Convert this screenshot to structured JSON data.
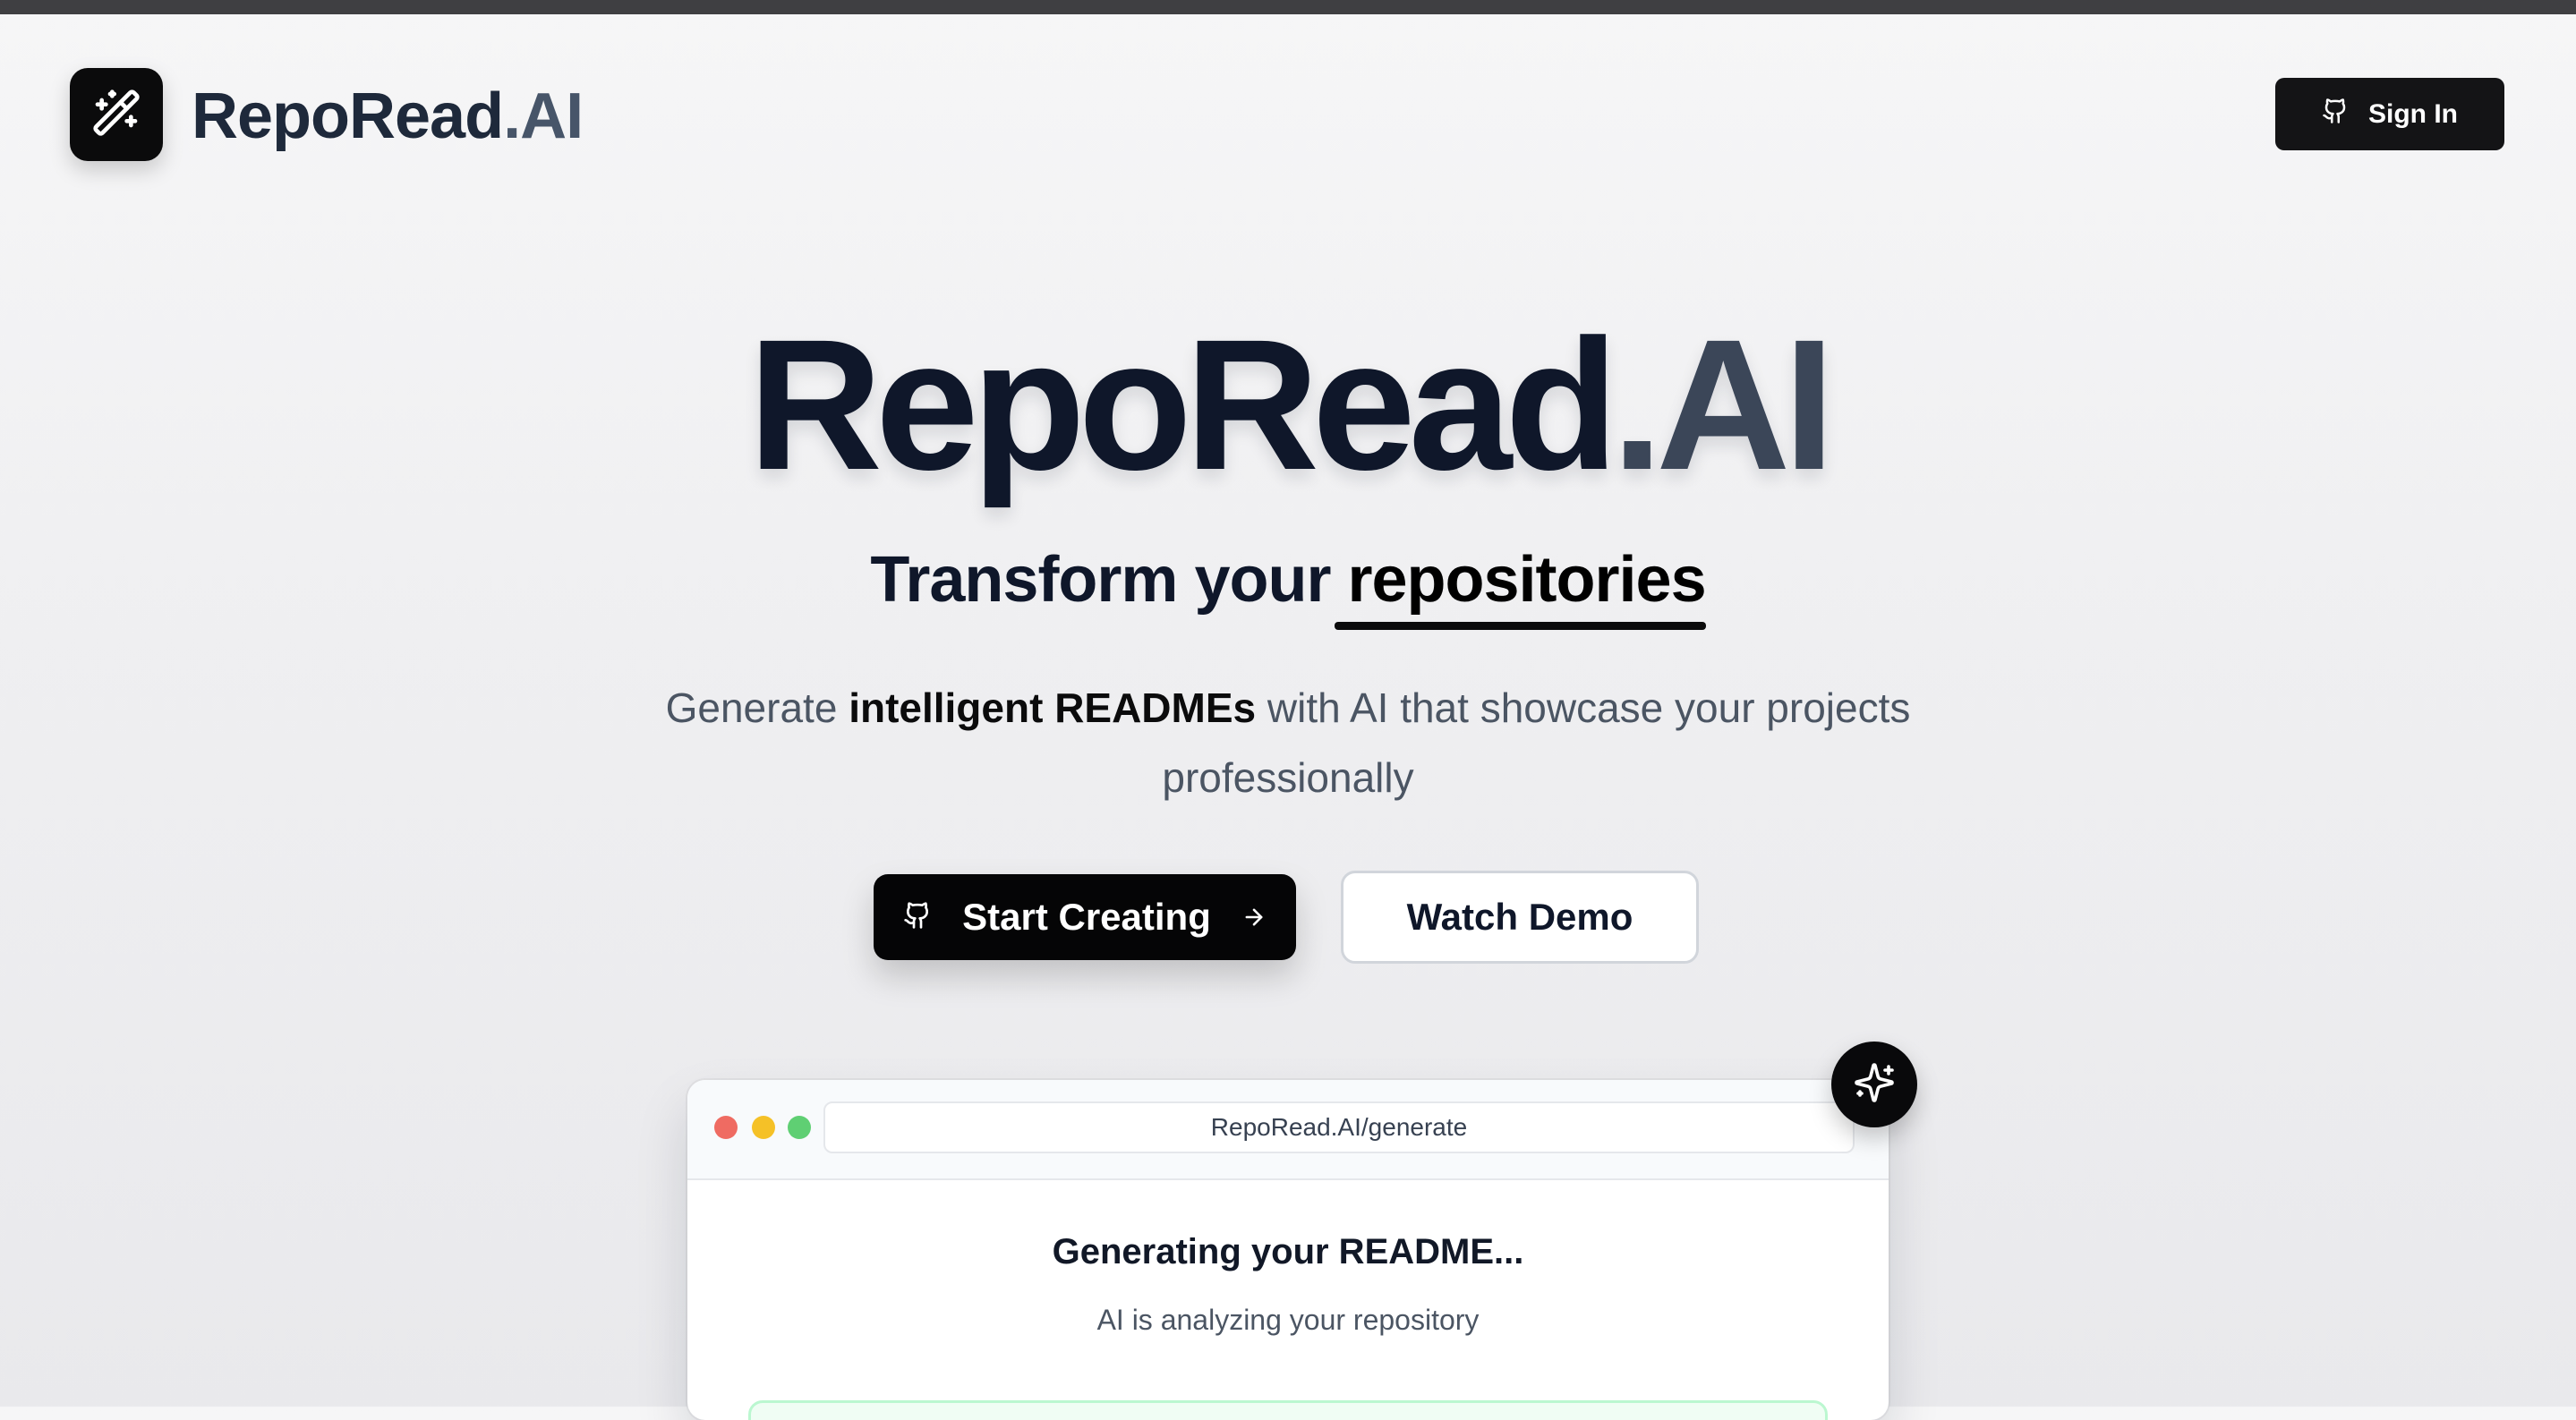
{
  "header": {
    "brand_part1": "RepoRead",
    "brand_part2": ".AI",
    "logo_icon": "magic-wand-icon",
    "signin_label": "Sign In",
    "signin_icon": "github-icon"
  },
  "hero": {
    "title_part1": "RepoRead",
    "title_part2": ".AI",
    "tagline_prefix": "Transform your ",
    "tagline_highlight": "repositories",
    "subtitle_prefix": "Generate ",
    "subtitle_bold": "intelligent READMEs",
    "subtitle_suffix": " with AI that showcase your projects professionally"
  },
  "cta": {
    "start_label": "Start Creating",
    "start_icon": "github-icon",
    "start_arrow_icon": "arrow-right-icon",
    "demo_label": "Watch Demo"
  },
  "mockup": {
    "url": "RepoRead.AI/generate",
    "status_title": "Generating your README...",
    "status_subtitle": "AI is analyzing your repository",
    "badge_icon": "sparkles-icon"
  },
  "colors": {
    "primary": "#0b0b0c",
    "brand_dark": "#1e293b",
    "brand_muted": "#475569",
    "traffic_red": "#ef6b62",
    "traffic_yellow": "#f5c127",
    "traffic_green": "#5fcf73",
    "progress_border": "#bbf7d0"
  }
}
